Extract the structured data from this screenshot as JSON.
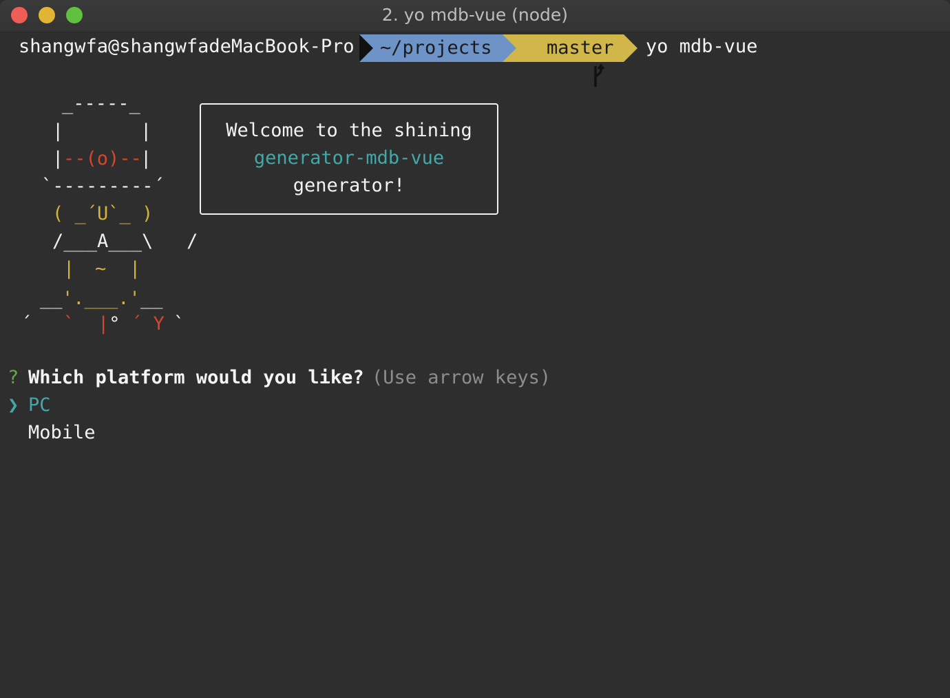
{
  "window": {
    "title": "2. yo mdb-vue (node)",
    "traffic_lights": [
      "close",
      "minimize",
      "zoom"
    ]
  },
  "prompt": {
    "user_host": "shangwfa@shangwfadeMacBook-Pro",
    "directory": "~/projects",
    "git_icon": "git-branch-icon",
    "git_branch": "master",
    "command": "yo mdb-vue"
  },
  "yeoman_art": {
    "line1": "_-----_",
    "line2_left": "|",
    "line2_right": "|",
    "line3_left": "|",
    "line3_mid": "--(o)--",
    "line3_right": "|",
    "line4": "`---------´",
    "line5": "( _´U`_ )",
    "line6": "/___A___\\   /",
    "line7_left": "|",
    "line7_mid": "~",
    "line7_right": "|",
    "line8_a": "__",
    "line8_b": "'.___.'",
    "line8_c": "__",
    "line9_a": "´",
    "line9_b": "`",
    "line9_c": "|°",
    "line9_d": "´ Y",
    "line9_e": "`"
  },
  "welcome_box": {
    "line1": "Welcome to the shining",
    "line2": "generator-mdb-vue",
    "line3": "generator!"
  },
  "question": {
    "mark": "?",
    "text": "Which platform would you like?",
    "hint": "(Use arrow keys)",
    "pointer": "❯",
    "options": [
      "PC",
      "Mobile"
    ],
    "selected": "PC"
  },
  "colors": {
    "background": "#2e2e2e",
    "dir_segment": "#6d93c7",
    "git_segment": "#d1b74a",
    "accent_cyan": "#43a8a8",
    "accent_red": "#d9442d",
    "accent_yellow": "#d4b23c",
    "accent_green": "#6aa548"
  }
}
